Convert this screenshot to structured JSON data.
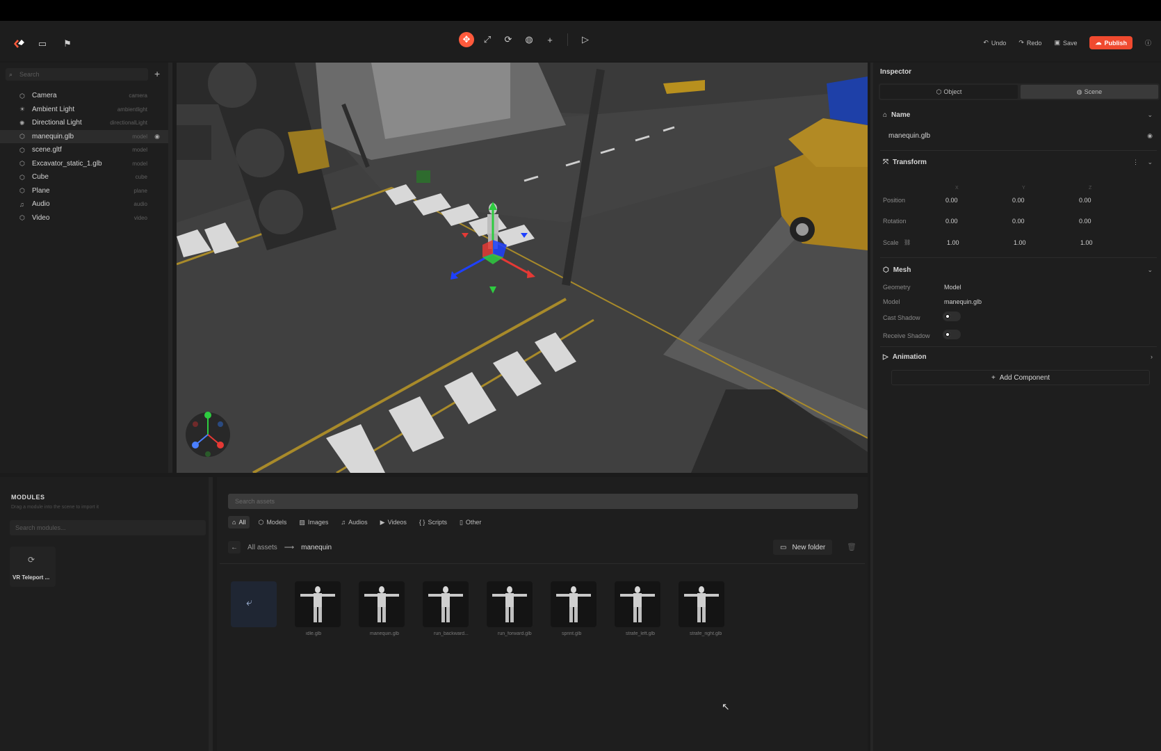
{
  "toolbar": {
    "undo": "Undo",
    "redo": "Redo",
    "save": "Save",
    "publish": "Publish"
  },
  "hierarchy": {
    "search_placeholder": "Search",
    "items": [
      {
        "name": "Camera",
        "type": "camera",
        "icon": "cube-icon"
      },
      {
        "name": "Ambient Light",
        "type": "ambientlight",
        "icon": "light-icon"
      },
      {
        "name": "Directional Light",
        "type": "directionalLight",
        "icon": "sun-icon"
      },
      {
        "name": "manequin.glb",
        "type": "model",
        "icon": "cube-icon",
        "selected": true
      },
      {
        "name": "scene.gltf",
        "type": "model",
        "icon": "cube-icon"
      },
      {
        "name": "Excavator_static_1.glb",
        "type": "model",
        "icon": "cube-icon"
      },
      {
        "name": "Cube",
        "type": "cube",
        "icon": "cube-icon"
      },
      {
        "name": "Plane",
        "type": "plane",
        "icon": "cube-icon"
      },
      {
        "name": "Audio",
        "type": "audio",
        "icon": "music-icon"
      },
      {
        "name": "Video",
        "type": "video",
        "icon": "cube-icon"
      }
    ]
  },
  "inspector": {
    "title": "Inspector",
    "tabs": {
      "object": "Object",
      "scene": "Scene"
    },
    "name_section": "Name",
    "name_value": "manequin.glb",
    "transform_section": "Transform",
    "axes": {
      "x": "X",
      "y": "Y",
      "z": "Z"
    },
    "position_label": "Position",
    "rotation_label": "Rotation",
    "scale_label": "Scale",
    "position": [
      "0.00",
      "0.00",
      "0.00"
    ],
    "rotation": [
      "0.00",
      "0.00",
      "0.00"
    ],
    "scale": [
      "1.00",
      "1.00",
      "1.00"
    ],
    "mesh_section": "Mesh",
    "geometry_label": "Geometry",
    "geometry_value": "Model",
    "model_label": "Model",
    "model_value": "manequin.glb",
    "cast_shadow_label": "Cast Shadow",
    "receive_shadow_label": "Receive Shadow",
    "animation_section": "Animation",
    "add_component": "Add Component"
  },
  "modules": {
    "title": "MODULES",
    "subtitle": "Drag a module into the scene to import it",
    "search_placeholder": "Search modules...",
    "items": [
      {
        "label": "VR Teleport ..."
      }
    ]
  },
  "assets": {
    "search_placeholder": "Search assets",
    "filters": [
      "All",
      "Models",
      "Images",
      "Audios",
      "Videos",
      "Scripts",
      "Other"
    ],
    "breadcrumb_all": "All assets",
    "breadcrumb_current": "manequin",
    "new_folder": "New folder",
    "files": [
      "idle.glb",
      "manequin.glb",
      "run_backward...",
      "run_forward.glb",
      "sprint.glb",
      "strafe_left.glb",
      "strafe_right.glb"
    ]
  },
  "colors": {
    "accent": "#f04a2f",
    "panel": "#1e1e1e",
    "gizmo_x": "#e53935",
    "gizmo_y": "#2ecc40",
    "gizmo_z": "#1e40ff"
  }
}
